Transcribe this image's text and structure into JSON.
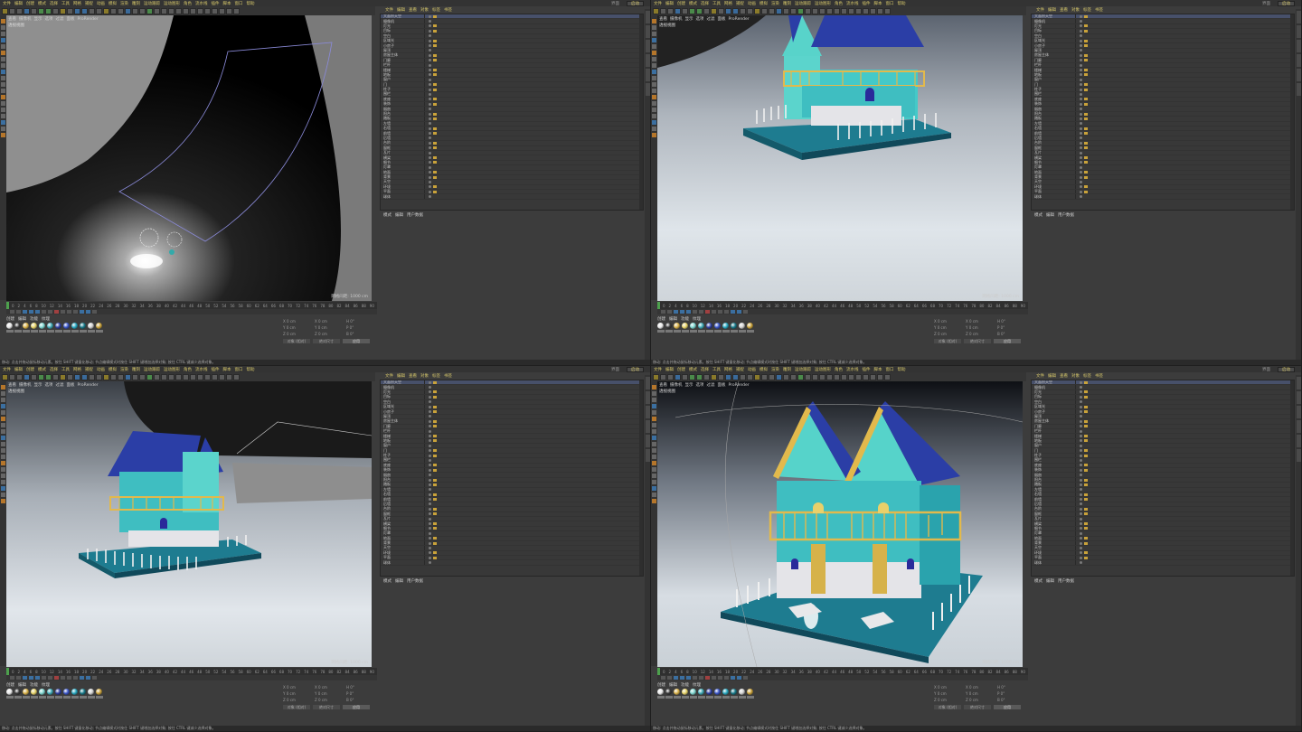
{
  "menus": [
    "文件",
    "编辑",
    "创建",
    "模式",
    "选择",
    "工具",
    "网格",
    "捕捉",
    "动画",
    "模拟",
    "渲染",
    "雕刻",
    "运动跟踪",
    "运动图形",
    "角色",
    "流水线",
    "插件",
    "脚本",
    "窗口",
    "帮助"
  ],
  "layout": {
    "label": "界面",
    "value": "启动"
  },
  "object_manager": {
    "tabs": [
      "文件",
      "编辑",
      "查看",
      "对象",
      "标签",
      "书签"
    ],
    "rows": [
      "大面积天空",
      "摄像机",
      "灯光",
      "目标",
      "空白",
      "区域光",
      "小房子",
      "屋顶",
      "房屋主体",
      "门廊",
      "栏杆",
      "楼梯",
      "地板",
      "窗户",
      "门",
      "柱子",
      "围栏",
      "底座",
      "装饰",
      "烟囱",
      "阳台",
      "踏板",
      "左墙",
      "右墙",
      "前墙",
      "后墙",
      "台阶",
      "窗框",
      "瓦片",
      "横梁",
      "细节",
      "灯罩",
      "地面",
      "背景",
      "天空",
      "环境",
      "平面",
      "球体"
    ]
  },
  "attributes": {
    "tabs": [
      "模式",
      "编辑",
      "用户数据"
    ]
  },
  "viewports": [
    {
      "view": "透视视图",
      "status": "网格间距: 1000 cm",
      "frame": "0 F"
    },
    {
      "view": "透视视图",
      "status": "网格间距: 1000 cm",
      "frame": "0 F"
    },
    {
      "view": "透视视图",
      "status": "网格间距: 1000 cm",
      "frame": "0 F"
    },
    {
      "view": "透视视图",
      "status": "网格间距: 1000 cm",
      "frame": "0 F"
    }
  ],
  "vp_menu": [
    "查看",
    "摄像机",
    "显示",
    "选项",
    "过滤",
    "面板",
    "ProRender"
  ],
  "timeline": {
    "ticks": [
      "0",
      "2",
      "4",
      "6",
      "8",
      "10",
      "12",
      "14",
      "16",
      "18",
      "20",
      "22",
      "24",
      "26",
      "28",
      "30",
      "32",
      "34",
      "36",
      "38",
      "40",
      "42",
      "44",
      "46",
      "48",
      "50",
      "52",
      "54",
      "56",
      "58",
      "60",
      "62",
      "64",
      "66",
      "68",
      "70",
      "72",
      "74",
      "76",
      "78",
      "80",
      "82",
      "84",
      "86",
      "88",
      "90"
    ]
  },
  "materials": {
    "tabs": [
      "创建",
      "编辑",
      "功能",
      "纹理"
    ],
    "colors": [
      "#e8e8e8",
      "#3a3a3a",
      "#d9b24a",
      "#e6d36a",
      "#7fd6d0",
      "#3fa9b5",
      "#2f3fa0",
      "#3a56c8",
      "#29a8c0",
      "#1a7a8a",
      "#d0d0d0",
      "#c9a23a"
    ]
  },
  "coordinates": {
    "rows": [
      [
        "X 0 cm",
        "X 0 cm",
        "H 0°"
      ],
      [
        "Y 0 cm",
        "Y 0 cm",
        "P 0°"
      ],
      [
        "Z 0 cm",
        "Z 0 cm",
        "B 0°"
      ]
    ],
    "mode": "对象 (相对)",
    "size": "绝对尺寸",
    "apply": "应用"
  },
  "statusbar": "移动: 点击并拖动鼠标移动元素。按住 SHIFT 键量化移动; 节点编辑模式时按住 SHIFT 键增加选择对象; 按住 CTRL 键减少选择对象。"
}
